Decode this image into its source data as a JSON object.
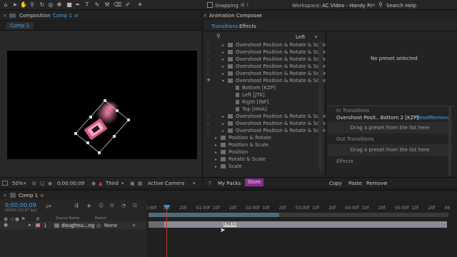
{
  "toolbar": {
    "snapping_label": "Snapping",
    "workspace_label": "Workspace:",
    "workspace_value": "AC Video - Handy Pac",
    "search_label": "Search Help",
    "tools": [
      "home-icon",
      "arrow-icon",
      "hand-icon",
      "zoom-icon",
      "rotate-icon",
      "camera-orbit-icon",
      "pan-behind-icon",
      "rectangle-icon",
      "pen-icon",
      "text-icon",
      "brush-icon",
      "clone-stamp-icon",
      "eraser-icon",
      "roto-brush-icon",
      "puppet-pin-icon"
    ]
  },
  "composition_panel": {
    "close_glyph": "×",
    "tab_prefix": "Composition",
    "tab_name": "Comp 1",
    "menu_glyph": "≡",
    "sub_tab": "Comp 1",
    "bottom": {
      "zoom": "50%",
      "timecode": "0;00;00;09",
      "view_mode": "Third",
      "camera": "Active Camera"
    }
  },
  "animation_composer": {
    "close_glyph": "×",
    "title": "Animation Composer",
    "menu_glyph": "≡",
    "tabs": [
      "Transitions",
      "Effects"
    ],
    "direction": "Left",
    "tree": [
      {
        "label": "Overshoot Position & Rotate & Scale 4",
        "arrow": "▸",
        "indent": 0
      },
      {
        "label": "Overshoot Position & Rotate & Scale D",
        "arrow": "▸",
        "indent": 0
      },
      {
        "label": "Overshoot Position & Rotate & Scale D",
        "arrow": "▸",
        "indent": 0
      },
      {
        "label": "Overshoot Position & Rotate & Scale D",
        "arrow": "▸",
        "indent": 0
      },
      {
        "label": "Overshoot Position & Rotate & Scale T",
        "arrow": "▸",
        "indent": 0
      },
      {
        "label": "Overshoot Position & Rotate & Scale T",
        "arrow": "▾",
        "indent": 0
      },
      {
        "label": "Bottom [KZP]",
        "arrow": "",
        "indent": 1
      },
      {
        "label": "Left [JTK]",
        "arrow": "",
        "indent": 1
      },
      {
        "label": "Right [INF]",
        "arrow": "",
        "indent": 1
      },
      {
        "label": "Top [HHA]",
        "arrow": "",
        "indent": 1
      },
      {
        "label": "Overshoot Position & Rotate & Scale T",
        "arrow": "▸",
        "indent": 0
      },
      {
        "label": "Overshoot Position & Rotate & Scale T",
        "arrow": "▸",
        "indent": 0
      },
      {
        "label": "Overshoot Position & Rotate & Scale T",
        "arrow": "▸",
        "indent": 0
      },
      {
        "label": "Position & Rotate",
        "arrow": "▸",
        "indent": -1
      },
      {
        "label": "Position & Scale",
        "arrow": "▸",
        "indent": -1
      },
      {
        "label": "Position",
        "arrow": "▸",
        "indent": -1
      },
      {
        "label": "Rotate & Scale",
        "arrow": "▸",
        "indent": -1
      },
      {
        "label": "Scale",
        "arrow": "▸",
        "indent": -1
      }
    ],
    "no_preset": "No preset selected",
    "in_transitions": "In Transitions",
    "selected_preset": "Overshoot Posit.. Bottom 2 [KZP]",
    "reset": "Reset",
    "remove": "Remove",
    "drag_hint_1": "Drag a preset from the list here",
    "out_transitions": "Out Transitions",
    "drag_hint_2": "Drag a preset from the list here",
    "effects": "Effects",
    "footer": {
      "help_glyph": "?",
      "my_packs": "My Packs",
      "store": "Store",
      "copy": "Copy",
      "paste": "Paste",
      "remove": "Remove"
    }
  },
  "timeline": {
    "close_glyph": "×",
    "tab_name": "Comp 1",
    "menu_glyph": "≡",
    "timecode": "0;00;00;09",
    "timecode_sub": "00009 (29.97 fps)",
    "search_placeholder": "ρ▾",
    "col_source": "Source Name",
    "col_parent": "Parent",
    "layer_number": "1",
    "layer_name": "doughnu...ng",
    "layer_parent": "None",
    "keyframe_label": "I:TR In",
    "ruler_ticks": [
      "):00f",
      "10f",
      "20f",
      "01:00f",
      "10f",
      "20f",
      "02:00f",
      "10f",
      "20f",
      "03:00f",
      "10f",
      "20f",
      "04:00f",
      "10f",
      "20f",
      "05:00f",
      "10f",
      "20f",
      "06"
    ]
  },
  "colors": {
    "accent_blue": "#4aa3e8",
    "store_purple": "#8a2c8f",
    "playhead_red": "#c0392b"
  }
}
